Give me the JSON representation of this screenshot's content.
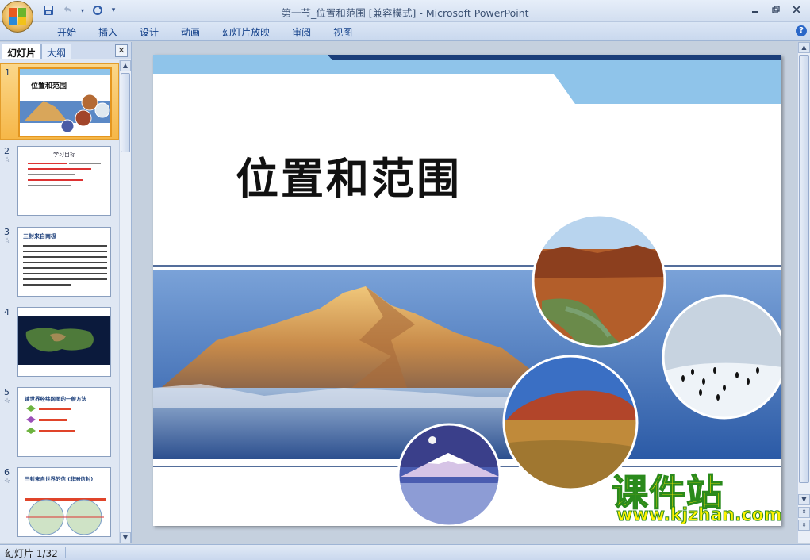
{
  "window": {
    "title": "第一节_位置和范围 [兼容模式] - Microsoft PowerPoint"
  },
  "qat": {
    "save_icon": "save-icon",
    "undo_icon": "undo-icon",
    "redo_icon": "redo-icon"
  },
  "ribbon": {
    "tabs": [
      "开始",
      "插入",
      "设计",
      "动画",
      "幻灯片放映",
      "审阅",
      "视图"
    ]
  },
  "left_pane": {
    "tabs": [
      "幻灯片",
      "大纲"
    ],
    "thumbnails": [
      {
        "num": "1",
        "title": "位置和范围"
      },
      {
        "num": "2",
        "title": "学习目标"
      },
      {
        "num": "3",
        "title": "三封来自南极"
      },
      {
        "num": "4",
        "title": ""
      },
      {
        "num": "5",
        "title": "读世界经纬网图的一般方法"
      },
      {
        "num": "6",
        "title": "三封来自世界的信 (非洲信封)"
      }
    ]
  },
  "slide": {
    "title": "位置和范围"
  },
  "watermark": {
    "line1": "课件站",
    "line2": "www.kjzhan.com"
  },
  "status": {
    "slide_info": "幻灯片 1/32"
  },
  "colors": {
    "accent_light_blue": "#8fc4ea",
    "accent_navy": "#1b3e7a",
    "selected_thumb": "#f6b748"
  }
}
